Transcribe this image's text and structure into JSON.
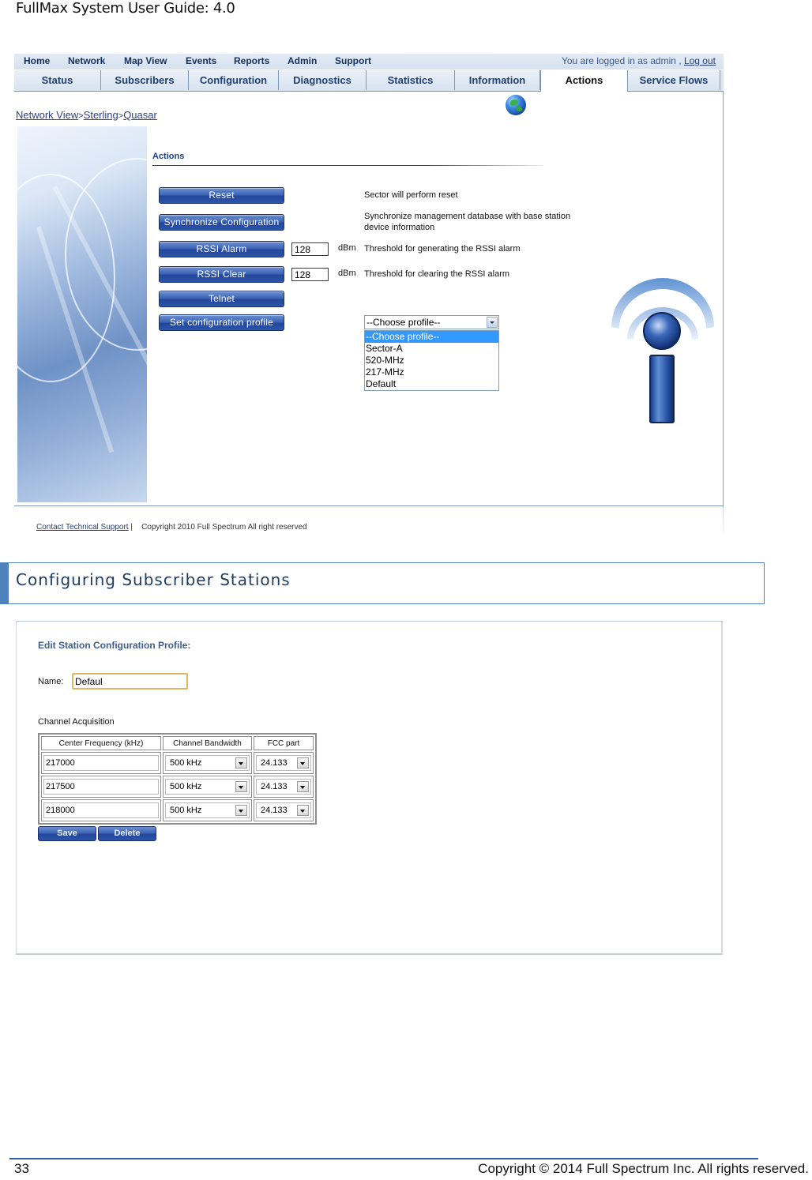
{
  "document": {
    "header": "FullMax System User Guide: 4.0",
    "section_heading": "Configuring Subscriber Stations",
    "page_number": "33",
    "copyright": "Copyright © 2014 Full Spectrum Inc. All rights reserved."
  },
  "actions_screen": {
    "top_nav": [
      "Home",
      "Network",
      "Map View",
      "Events",
      "Reports",
      "Admin",
      "Support"
    ],
    "login_text": "You are logged in as admin ,",
    "logout_label": "Log out",
    "tabs": [
      {
        "label": "Status",
        "active": false
      },
      {
        "label": "Subscribers",
        "active": false
      },
      {
        "label": "Configuration",
        "active": false
      },
      {
        "label": "Diagnostics",
        "active": false
      },
      {
        "label": "Statistics",
        "active": false
      },
      {
        "label": "Information",
        "active": false
      },
      {
        "label": "Actions",
        "active": true
      },
      {
        "label": "Service Flows",
        "active": false
      }
    ],
    "breadcrumb": {
      "items": [
        "Network View",
        "Sterling",
        "Quasar"
      ],
      "separator": ">"
    },
    "section_title": "Actions",
    "buttons": {
      "reset": "Reset",
      "sync": "Synchronize Configuration",
      "rssi_alarm": "RSSI Alarm",
      "rssi_clear": "RSSI Clear",
      "telnet": "Telnet",
      "set_profile": "Set configuration profile"
    },
    "rssi_alarm_value": "128",
    "rssi_clear_value": "128",
    "unit": "dBm",
    "descriptions": {
      "reset": "Sector will perform reset",
      "sync_line1": "Synchronize management database with base station",
      "sync_line2": "device information",
      "rssi_alarm": "Threshold for generating the RSSI alarm",
      "rssi_clear": "Threshold for clearing the RSSI alarm"
    },
    "profile_select": {
      "selected": "--Choose profile--",
      "options": [
        "--Choose profile--",
        "Sector-A",
        "520-MHz",
        "217-MHz",
        "Default"
      ],
      "highlighted_index": 0
    },
    "footer": {
      "support_link": "Contact Technical Support",
      "divider": "|",
      "copyright": "Copyright 2010 Full Spectrum All right reserved"
    }
  },
  "profile_screen": {
    "title": "Edit Station Configuration Profile:",
    "name_label": "Name:",
    "name_value": "Defaul",
    "channel_label": "Channel Acquisition",
    "columns": [
      "Center Frequency (kHz)",
      "Channel Bandwidth",
      "FCC part"
    ],
    "rows": [
      {
        "frequency": "217000",
        "bandwidth": "500 kHz",
        "fcc": "24.133"
      },
      {
        "frequency": "217500",
        "bandwidth": "500 kHz",
        "fcc": "24.133"
      },
      {
        "frequency": "218000",
        "bandwidth": "500 kHz",
        "fcc": "24.133"
      }
    ],
    "save_label": "Save",
    "delete_label": "Delete"
  }
}
